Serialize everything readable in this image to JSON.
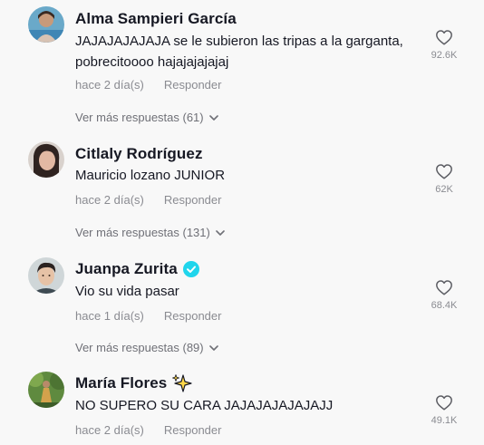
{
  "comments": [
    {
      "username": "Alma Sampieri García",
      "text": "JAJAJAJAJAJA se le subieron las tripas a la garganta, pobrecitoooo hajajajajajaj",
      "time": "hace 2 día(s)",
      "reply": "Responder",
      "likes": "92.6K",
      "more_replies": "Ver más respuestas (61)"
    },
    {
      "username": "Citlaly Rodríguez",
      "text": "Mauricio lozano JUNIOR",
      "time": "hace 2 día(s)",
      "reply": "Responder",
      "likes": "62K",
      "more_replies": "Ver más respuestas (131)"
    },
    {
      "username": "Juanpa Zurita",
      "text": "Vio su vida pasar",
      "time": "hace 1 día(s)",
      "reply": "Responder",
      "likes": "68.4K",
      "more_replies": "Ver más respuestas (89)"
    },
    {
      "username": "María Flores",
      "text": "NO SUPERO SU CARA JAJAJAJAJAJAJJ",
      "time": "hace 2 día(s)",
      "reply": "Responder",
      "likes": "49.1K"
    }
  ],
  "colors": {
    "text": "#161823",
    "muted": "#8a8b91",
    "verified": "#20d5ec",
    "background": "#f8f8f8"
  }
}
